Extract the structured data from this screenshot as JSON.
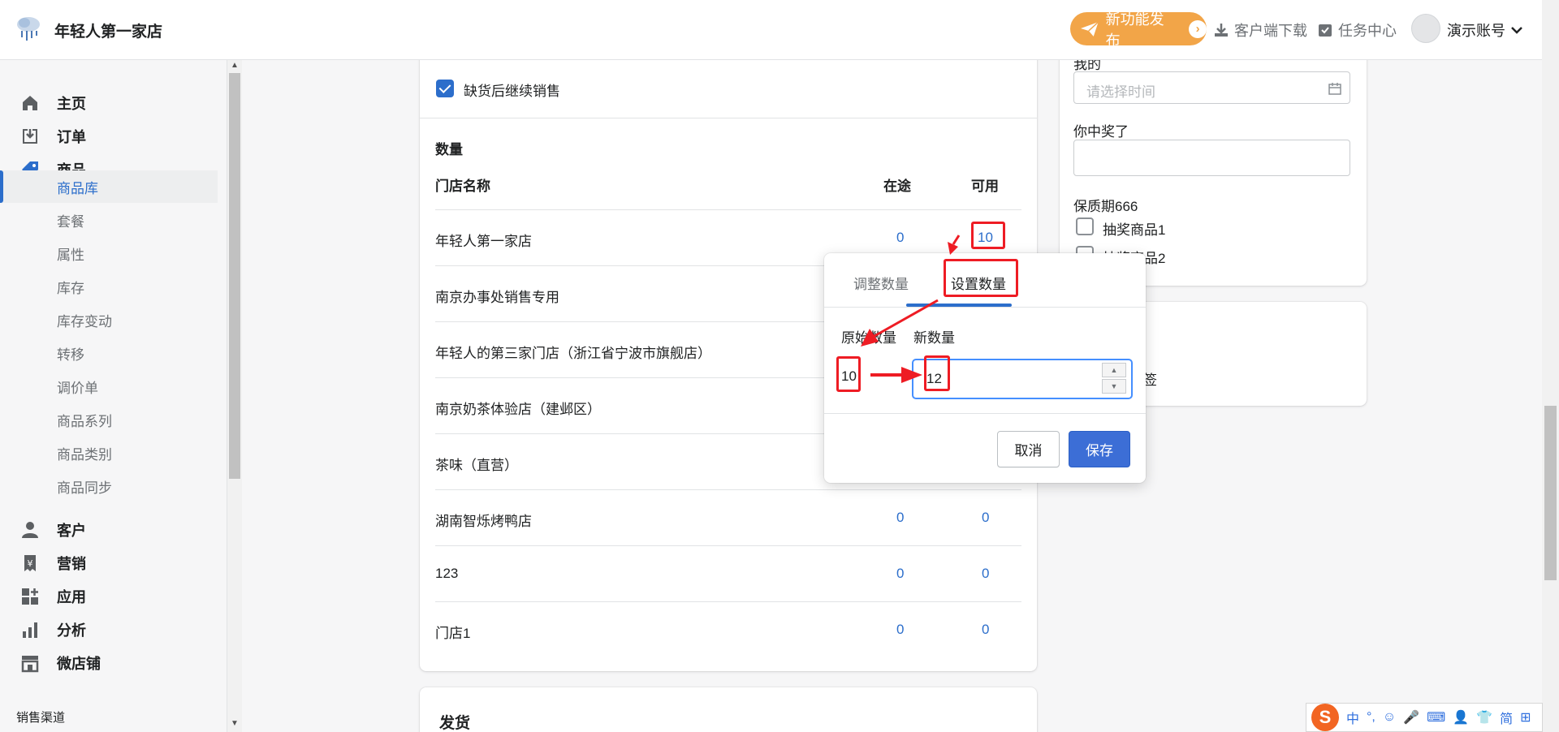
{
  "topbar": {
    "shop_name": "年轻人第一家店",
    "promo_label": "新功能发布",
    "download_label": "客户端下载",
    "tasks_label": "任务中心",
    "account_label": "演示账号"
  },
  "sidebar": {
    "items": [
      {
        "label": "主页",
        "icon": "home-icon"
      },
      {
        "label": "订单",
        "icon": "order-icon"
      },
      {
        "label": "商品",
        "icon": "tag-icon"
      },
      {
        "label": "客户",
        "icon": "person-icon"
      },
      {
        "label": "营销",
        "icon": "yen-icon"
      },
      {
        "label": "应用",
        "icon": "apps-icon"
      },
      {
        "label": "分析",
        "icon": "bar-chart-icon"
      },
      {
        "label": "微店铺",
        "icon": "store-icon"
      }
    ],
    "subitems": [
      "商品库",
      "套餐",
      "属性",
      "库存",
      "库存变动",
      "转移",
      "调价单",
      "商品系列",
      "商品类别",
      "商品同步"
    ],
    "active_subitem": "商品库",
    "section_label": "销售渠道"
  },
  "inventory": {
    "continue_selling_label": "缺货后继续销售",
    "continue_selling_checked": true,
    "quantity_heading": "数量",
    "col_store": "门店名称",
    "col_in_transit": "在途",
    "col_available": "可用",
    "rows": [
      {
        "store": "年轻人第一家店",
        "in_transit": "0",
        "available": "10"
      },
      {
        "store": "南京办事处销售专用",
        "in_transit": "",
        "available": ""
      },
      {
        "store": "年轻人的第三家门店（浙江省宁波市旗舰店）",
        "in_transit": "",
        "available": ""
      },
      {
        "store": "南京奶茶体验店（建邺区）",
        "in_transit": "",
        "available": ""
      },
      {
        "store": "茶味（直营）",
        "in_transit": "",
        "available": ""
      },
      {
        "store": "湖南智烁烤鸭店",
        "in_transit": "0",
        "available": "0"
      },
      {
        "store": "123",
        "in_transit": "0",
        "available": "0"
      },
      {
        "store": "门店1",
        "in_transit": "0",
        "available": "0"
      }
    ],
    "shipping_heading": "发货"
  },
  "right_panel": {
    "field1_label": "我的",
    "field1_placeholder": "请选择时间",
    "field2_label": "你中奖了",
    "shelf_life_label": "保质期666",
    "option1": "抽奖商品1",
    "option2": "抽奖商品2",
    "tags_label": "签"
  },
  "popover": {
    "tab_adjust": "调整数量",
    "tab_set": "设置数量",
    "active_tab": "设置数量",
    "original_label": "原始数量",
    "new_label": "新数量",
    "original_value": "10",
    "new_value": "12",
    "cancel_label": "取消",
    "save_label": "保存"
  },
  "ime": {
    "lang": "中",
    "punct": "°,",
    "mode": "简"
  },
  "colors": {
    "accent": "#2c6ecb",
    "promo": "#f2a548",
    "annotation": "#ee1c24",
    "primary_button": "#3c6ed6"
  }
}
